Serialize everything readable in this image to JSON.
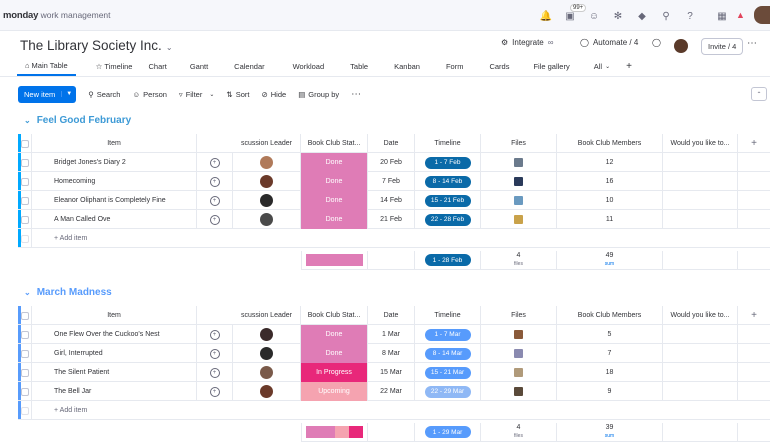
{
  "app": {
    "brand_bold": "monday",
    "brand_light": " work management",
    "notif_count": "99+"
  },
  "board": {
    "title": "The Library Society Inc.",
    "integrate": "Integrate",
    "automate": "Automate / 4",
    "invite": "Invite / 4"
  },
  "tabs": [
    "Main Table",
    "Timeline",
    "Chart",
    "Gantt",
    "Calendar",
    "Workload",
    "Table",
    "Kanban",
    "Form",
    "Cards",
    "File gallery",
    "All"
  ],
  "toolbar": {
    "new_item": "New item",
    "search": "Search",
    "person": "Person",
    "filter": "Filter",
    "sort": "Sort",
    "hide": "Hide",
    "group_by": "Group by"
  },
  "columns": [
    "Item",
    "scussion Leader",
    "Book Club Stat...",
    "Date",
    "Timeline",
    "Files",
    "Book Club Members",
    "Would you like to..."
  ],
  "groups": [
    {
      "name": "Feel Good February",
      "color": "#00a9ff",
      "title_color": "#3d9ad6",
      "rows": [
        {
          "item": "Bridget Jones's Diary 2",
          "status": "Done",
          "status_color": "#df7cb6",
          "date": "20 Feb",
          "timeline": "1 - 7 Feb",
          "timeline_color": "#0a6aa8",
          "members": "12",
          "file_color": "#6b7a8c",
          "face_color": "#b07a5a"
        },
        {
          "item": "Homecoming",
          "status": "Done",
          "status_color": "#df7cb6",
          "date": "7 Feb",
          "timeline": "8 - 14 Feb",
          "timeline_color": "#0a6aa8",
          "members": "16",
          "file_color": "#2a3a5a",
          "face_color": "#6b3a2a"
        },
        {
          "item": "Eleanor Oliphant is Completely Fine",
          "status": "Done",
          "status_color": "#df7cb6",
          "date": "14 Feb",
          "timeline": "15 - 21 Feb",
          "timeline_color": "#0a6aa8",
          "members": "10",
          "file_color": "#6a9ac0",
          "face_color": "#2a2a2a"
        },
        {
          "item": "A Man Called Ove",
          "status": "Done",
          "status_color": "#df7cb6",
          "date": "21 Feb",
          "timeline": "22 - 28 Feb",
          "timeline_color": "#0a6aa8",
          "members": "11",
          "file_color": "#c9a24a",
          "face_color": "#4a4a4a"
        }
      ],
      "add_item": "+ Add item",
      "summary": {
        "timeline": "1 - 28 Feb",
        "timeline_color": "#0a6aa8",
        "files_count": "4",
        "files_label": "files",
        "members_sum": "49",
        "sum_label": "sum",
        "status_bars": [
          {
            "color": "#df7cb6",
            "fraction": 1
          }
        ]
      }
    },
    {
      "name": "March Madness",
      "color": "#579bfc",
      "title_color": "#579bfc",
      "rows": [
        {
          "item": "One Flew Over the Cuckoo's Nest",
          "status": "Done",
          "status_color": "#df7cb6",
          "date": "1 Mar",
          "timeline": "1 - 7 Mar",
          "timeline_color": "#579bfc",
          "members": "5",
          "file_color": "#8a5a3a",
          "face_color": "#3a2a2a"
        },
        {
          "item": "Girl, Interrupted",
          "status": "Done",
          "status_color": "#df7cb6",
          "date": "8 Mar",
          "timeline": "8 - 14 Mar",
          "timeline_color": "#579bfc",
          "members": "7",
          "file_color": "#8a8ab0",
          "face_color": "#2a2a2a"
        },
        {
          "item": "The Silent Patient",
          "status": "In Progress",
          "status_color": "#e8287a",
          "date": "15 Mar",
          "timeline": "15 - 21 Mar",
          "timeline_color": "#579bfc",
          "members": "18",
          "file_color": "#b09a7a",
          "face_color": "#7a5a4a"
        },
        {
          "item": "The Bell Jar",
          "status": "Upcoming",
          "status_color": "#f5a3b0",
          "date": "22 Mar",
          "timeline": "22 - 29 Mar",
          "timeline_color": "#8fb8f5",
          "members": "9",
          "file_color": "#5a4a3a",
          "face_color": "#6b3a2a"
        }
      ],
      "add_item": "+ Add item",
      "summary": {
        "timeline": "1 - 29 Mar",
        "timeline_color": "#579bfc",
        "files_count": "4",
        "files_label": "files",
        "members_sum": "39",
        "sum_label": "sum",
        "status_bars": [
          {
            "color": "#df7cb6",
            "fraction": 0.5
          },
          {
            "color": "#f5a3b0",
            "fraction": 0.25
          },
          {
            "color": "#e8287a",
            "fraction": 0.25
          }
        ]
      }
    }
  ]
}
